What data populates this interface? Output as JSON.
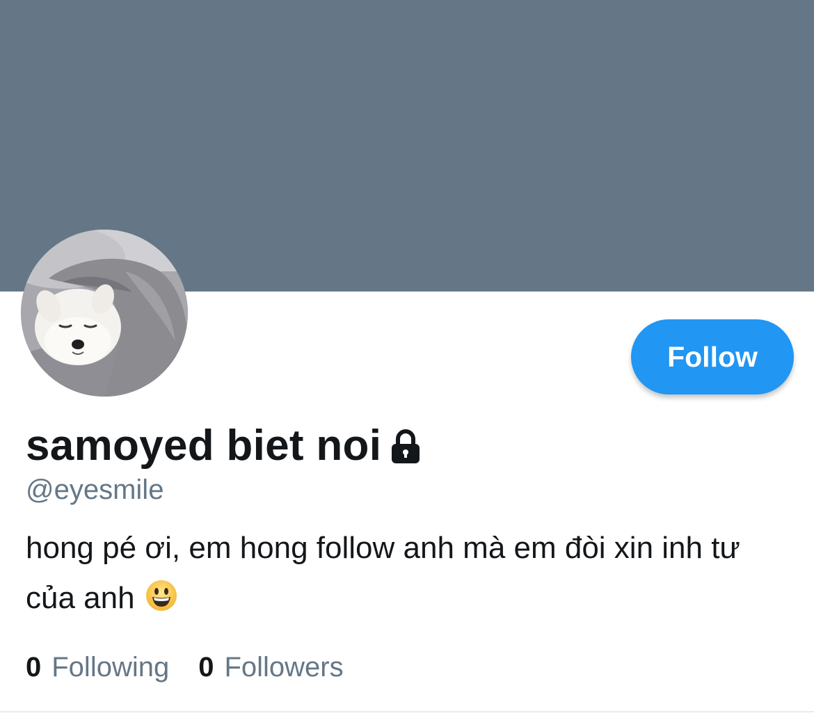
{
  "profile": {
    "display_name": "samoyed biet noi",
    "handle": "@eyesmile",
    "bio": "hong pé ơi, em hong follow anh mà em đòi xin inh tư của anh",
    "bio_emoji": "😃",
    "protected": true,
    "banner_color": "#657786",
    "avatar_icon": "samoyed-dog-photo"
  },
  "actions": {
    "follow_label": "Follow",
    "follow_color": "#2196f3"
  },
  "stats": {
    "following_count": "0",
    "following_label": "Following",
    "followers_count": "0",
    "followers_label": "Followers"
  }
}
